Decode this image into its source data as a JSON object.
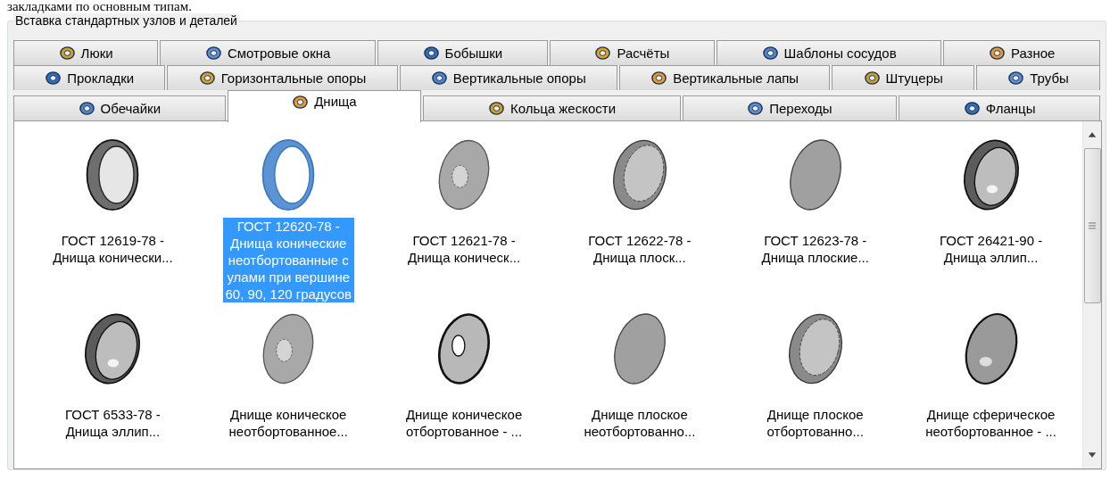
{
  "caption": "закладками по основным типам.",
  "group": {
    "title": "Вставка стандартных узлов и деталей"
  },
  "tab_rows": [
    [
      {
        "label": "Люки",
        "selected": false
      },
      {
        "label": "Смотровые окна",
        "selected": false
      },
      {
        "label": "Бобышки",
        "selected": false
      },
      {
        "label": "Расчёты",
        "selected": false
      },
      {
        "label": "Шаблоны сосудов",
        "selected": false
      },
      {
        "label": "Разное",
        "selected": false
      }
    ],
    [
      {
        "label": "Прокладки",
        "selected": false
      },
      {
        "label": "Горизонтальные опоры",
        "selected": false
      },
      {
        "label": "Вертикальные опоры",
        "selected": false
      },
      {
        "label": "Вертикальные лапы",
        "selected": false
      },
      {
        "label": "Штуцеры",
        "selected": false
      },
      {
        "label": "Трубы",
        "selected": false
      }
    ],
    [
      {
        "label": "Обечайки",
        "selected": false
      },
      {
        "label": "Днища",
        "selected": true
      },
      {
        "label": "Кольца жескости",
        "selected": false
      },
      {
        "label": "Переходы",
        "selected": false
      },
      {
        "label": "Фланцы",
        "selected": false
      }
    ]
  ],
  "items": [
    {
      "kind": "ring",
      "selected": false,
      "lines": [
        "ГОСТ 12619-78 -",
        "Днища конически..."
      ]
    },
    {
      "kind": "ring",
      "selected": true,
      "lines": [
        "ГОСТ 12620-78 -",
        "Днища конические",
        "неотбортованные с",
        "улами при вершине",
        "60, 90, 120 градусов"
      ]
    },
    {
      "kind": "plate-hole",
      "selected": false,
      "lines": [
        "ГОСТ 12621-78 -",
        "Днища коническ..."
      ]
    },
    {
      "kind": "dish",
      "selected": false,
      "lines": [
        "ГОСТ 12622-78 -",
        "Днища плоск..."
      ]
    },
    {
      "kind": "disc",
      "selected": false,
      "lines": [
        "ГОСТ 12623-78 -",
        "Днища плоские..."
      ]
    },
    {
      "kind": "cap",
      "selected": false,
      "lines": [
        "ГОСТ 26421-90 -",
        "Днища эллип..."
      ]
    },
    {
      "kind": "cap",
      "selected": false,
      "lines": [
        "ГОСТ 6533-78 -",
        "Днища эллип..."
      ]
    },
    {
      "kind": "plate-hole",
      "selected": false,
      "lines": [
        "Днище коническое",
        "неотбортованное..."
      ]
    },
    {
      "kind": "dish-hole",
      "selected": false,
      "lines": [
        "Днище коническое",
        "отбортованное - ..."
      ]
    },
    {
      "kind": "disc",
      "selected": false,
      "lines": [
        "Днище плоское",
        "неотбортованно..."
      ]
    },
    {
      "kind": "dish",
      "selected": false,
      "lines": [
        "Днище плоское",
        "отбортованно..."
      ]
    },
    {
      "kind": "sphere",
      "selected": false,
      "lines": [
        "Днище сферическое",
        "неотбортованное - ..."
      ]
    }
  ]
}
